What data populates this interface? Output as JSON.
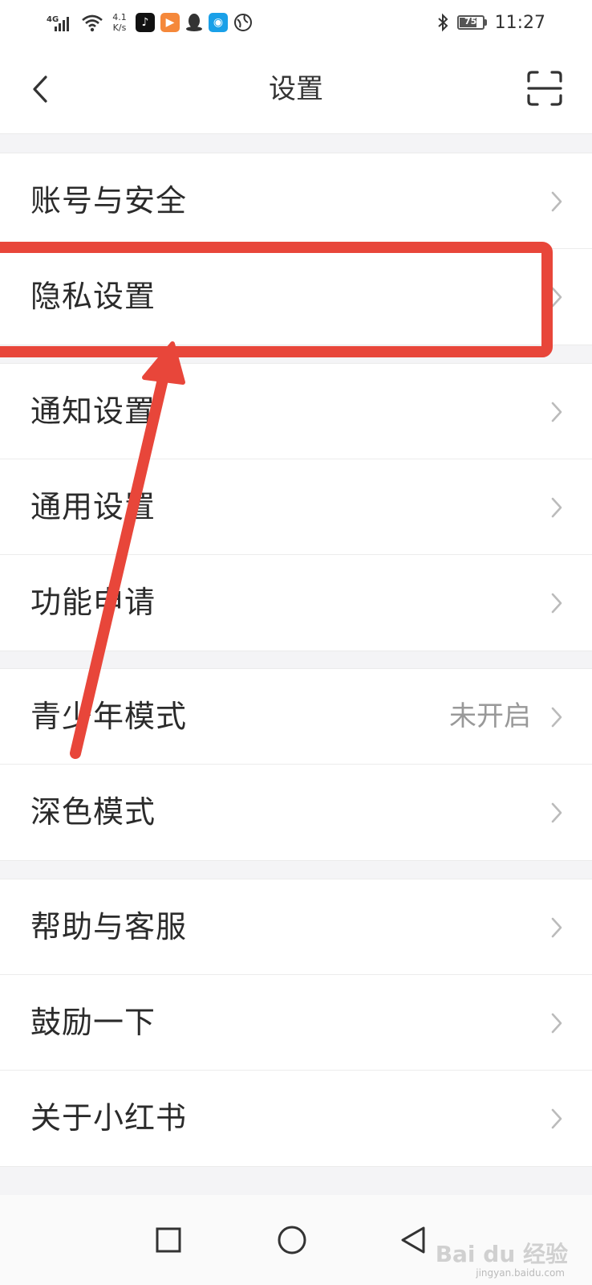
{
  "status_bar": {
    "network": "4G",
    "speed_value": "4.1",
    "speed_unit": "K/s",
    "battery": "75",
    "time": "11:27"
  },
  "nav": {
    "title": "设置"
  },
  "groups": [
    {
      "items": [
        {
          "label": "账号与安全",
          "value": ""
        },
        {
          "label": "隐私设置",
          "value": ""
        }
      ]
    },
    {
      "items": [
        {
          "label": "通知设置",
          "value": ""
        },
        {
          "label": "通用设置",
          "value": ""
        },
        {
          "label": "功能申请",
          "value": ""
        }
      ]
    },
    {
      "items": [
        {
          "label": "青少年模式",
          "value": "未开启"
        },
        {
          "label": "深色模式",
          "value": ""
        }
      ]
    },
    {
      "items": [
        {
          "label": "帮助与客服",
          "value": ""
        },
        {
          "label": "鼓励一下",
          "value": ""
        },
        {
          "label": "关于小红书",
          "value": ""
        }
      ]
    }
  ],
  "watermark": {
    "brand": "Bai du 经验",
    "url": "jingyan.baidu.com"
  },
  "annotation": {
    "color": "#e8463a",
    "highlighted_item": "隐私设置"
  }
}
